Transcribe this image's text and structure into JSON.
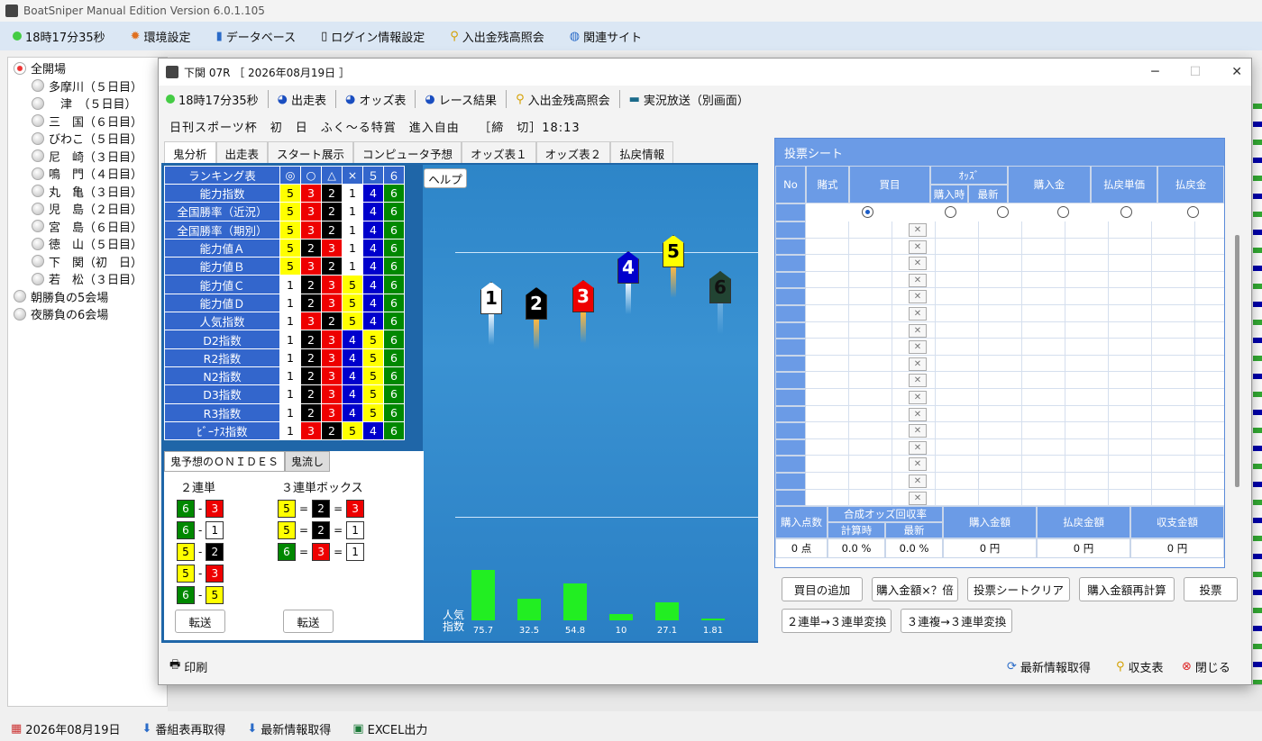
{
  "app": {
    "title": "BoatSniper Manual Edition Version 6.0.1.105"
  },
  "menu": {
    "clock": "18時17分35秒",
    "settings": "環境設定",
    "database": "データベース",
    "login": "ログイン情報設定",
    "balance": "入出金残高照会",
    "links": "関連サイト"
  },
  "tree": {
    "root": "全開場",
    "venues": [
      "多摩川（５日目）",
      "　津　（５日目）",
      "三　国（６日目）",
      "びわこ（５日目）",
      "尼　崎（３日目）",
      "鳴　門（４日目）",
      "丸　亀（３日目）",
      "児　島（２日目）",
      "宮　島（６日目）",
      "徳　山（５日目）",
      "下　関（初　日）",
      "若　松（３日目）"
    ],
    "groups": [
      "朝勝負の5会場",
      "夜勝負の6会場"
    ]
  },
  "bottom": {
    "date": "2026年08月19日",
    "refetch": "番組表再取得",
    "latest": "最新情報取得",
    "excel": "EXCEL出力"
  },
  "window": {
    "title": "下関 07R ［ 2026年08月19日 ］",
    "toolbar": {
      "clock": "18時17分35秒",
      "entry": "出走表",
      "odds": "オッズ表",
      "result": "レース結果",
      "balance": "入出金残高照会",
      "live": "実況放送（別画面）"
    },
    "race_info": "日刊スポーツ杯　初　日　ふく～る特賞　進入自由　　［締　切］18:13",
    "tabs": [
      "鬼分析",
      "出走表",
      "スタート展示",
      "コンピュータ予想",
      "オッズ表１",
      "オッズ表２",
      "払戻情報"
    ],
    "footer": {
      "print": "印刷",
      "refresh": "最新情報取得",
      "income": "収支表",
      "close": "閉じる"
    }
  },
  "ranking": {
    "headers": [
      "ランキング表",
      "◎",
      "○",
      "△",
      "×",
      "５",
      "６"
    ],
    "rows": [
      {
        "label": "能力指数",
        "v": [
          5,
          3,
          2,
          1,
          4,
          6
        ]
      },
      {
        "label": "全国勝率（近況）",
        "v": [
          5,
          3,
          2,
          1,
          4,
          6
        ]
      },
      {
        "label": "全国勝率（期別）",
        "v": [
          5,
          3,
          2,
          1,
          4,
          6
        ]
      },
      {
        "label": "能力値Ａ",
        "v": [
          5,
          2,
          3,
          1,
          4,
          6
        ]
      },
      {
        "label": "能力値Ｂ",
        "v": [
          5,
          3,
          2,
          1,
          4,
          6
        ]
      },
      {
        "label": "能力値Ｃ",
        "v": [
          1,
          2,
          3,
          5,
          4,
          6
        ]
      },
      {
        "label": "能力値Ｄ",
        "v": [
          1,
          2,
          3,
          5,
          4,
          6
        ]
      },
      {
        "label": "人気指数",
        "v": [
          1,
          3,
          2,
          5,
          4,
          6
        ]
      },
      {
        "label": "D2指数",
        "v": [
          1,
          2,
          3,
          4,
          5,
          6
        ]
      },
      {
        "label": "R2指数",
        "v": [
          1,
          2,
          3,
          4,
          5,
          6
        ]
      },
      {
        "label": "N2指数",
        "v": [
          1,
          2,
          3,
          4,
          5,
          6
        ]
      },
      {
        "label": "D3指数",
        "v": [
          1,
          2,
          3,
          4,
          5,
          6
        ]
      },
      {
        "label": "R3指数",
        "v": [
          1,
          2,
          3,
          4,
          5,
          6
        ]
      },
      {
        "label": "ﾋﾞｰﾅｽ指数",
        "v": [
          1,
          3,
          2,
          5,
          4,
          6
        ]
      }
    ],
    "help": "ヘルプ"
  },
  "onides": {
    "tab1": "鬼予想のＯＮＩＤＥＳ",
    "tab2": "鬼流し",
    "exacta_title": "２連単",
    "trio_title": "３連単ボックス",
    "exacta": [
      [
        6,
        3
      ],
      [
        6,
        1
      ],
      [
        5,
        2
      ],
      [
        5,
        3
      ],
      [
        6,
        5
      ]
    ],
    "trio": [
      [
        5,
        2,
        3
      ],
      [
        5,
        2,
        1
      ],
      [
        6,
        3,
        1
      ]
    ],
    "transfer": "転送"
  },
  "popularity": {
    "label": "人気\n指数",
    "values": [
      75.7,
      32.5,
      54.8,
      10.0,
      27.1,
      1.81
    ]
  },
  "ticket": {
    "title": "投票シート",
    "cols": {
      "no": "No",
      "type": "賭式",
      "bet": "買目",
      "odds": "ｵｯｽﾞ",
      "odds_buy": "購入時",
      "odds_latest": "最新",
      "amount": "購入金",
      "payout_unit": "払戻単価",
      "payout": "払戻金"
    },
    "summary_headers": {
      "points": "購入点数",
      "combined": "合成オッズ回収率",
      "calc": "計算時",
      "latest": "最新",
      "total": "購入金額",
      "refund": "払戻金額",
      "balance": "収支金額"
    },
    "summary_values": {
      "points": "0 点",
      "calc": "0.0 %",
      "latest": "0.0 %",
      "total": "0 円",
      "refund": "0 円",
      "balance": "0 円"
    },
    "buttons": [
      "買目の追加",
      "購入金額×？倍",
      "投票シートクリア",
      "購入金額再計算",
      "投票"
    ],
    "buttons2": [
      "２連単→３連単変換",
      "３連複→３連単変換"
    ]
  },
  "colors": {
    "accent": "#6b9be6",
    "c1": "#ffffff",
    "c2": "#000000",
    "c3": "#ee0000",
    "c4": "#0000cc",
    "c5": "#ffff00",
    "c6": "#008800"
  }
}
